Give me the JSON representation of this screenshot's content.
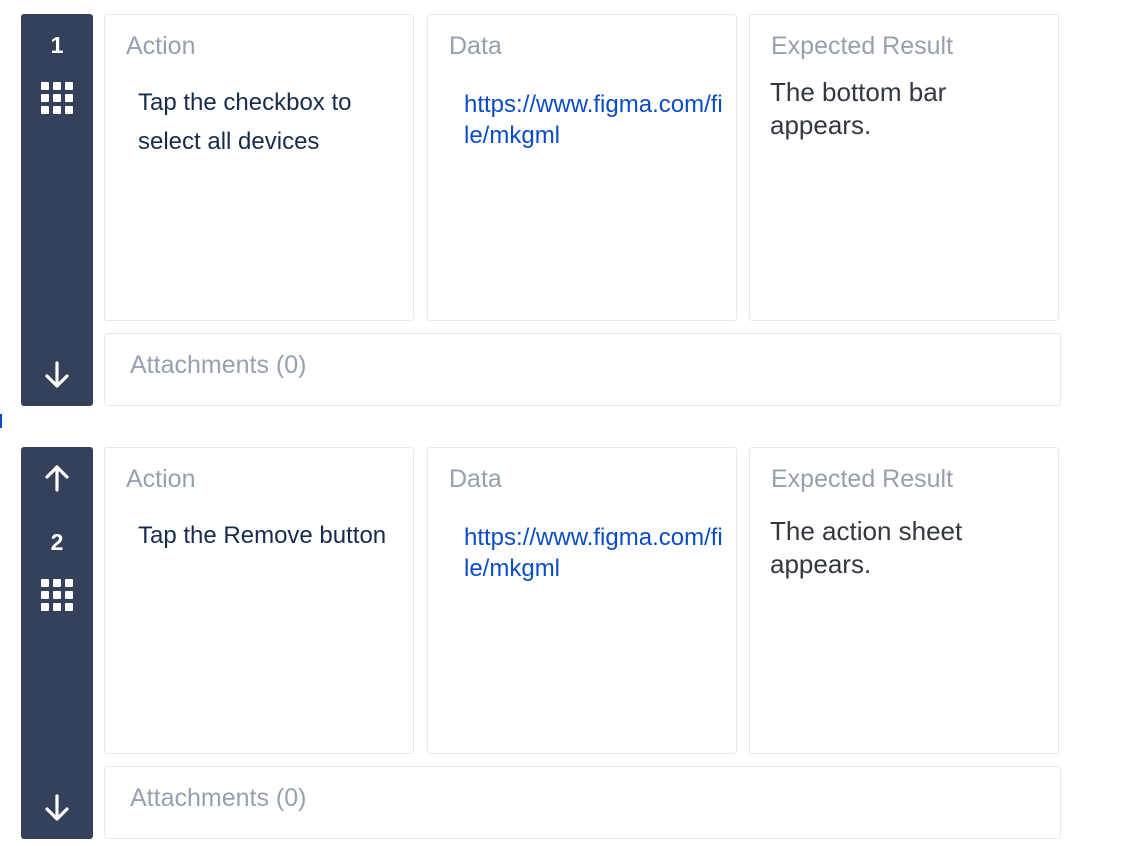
{
  "labels": {
    "action": "Action",
    "data": "Data",
    "expected": "Expected Result"
  },
  "steps": [
    {
      "number": "1",
      "action": "Tap the checkbox to select all devices",
      "data": "https://www.figma.com/file/mkgml",
      "expected": "The bottom bar appears.",
      "attachments": "Attachments (0)"
    },
    {
      "number": "2",
      "action": "Tap the Remove button",
      "data": "https://www.figma.com/file/mkgml",
      "expected": "The action sheet appears.",
      "attachments": "Attachments (0)"
    }
  ],
  "colors": {
    "rail": "#35405a",
    "link": "#0b4cc8",
    "label": "#97a0af",
    "action_text": "#172b4d",
    "border": "#e7e9ec"
  },
  "icons": {
    "drag": "drag-handle-icon",
    "move_down": "arrow-down-icon",
    "move_up": "arrow-up-icon"
  }
}
